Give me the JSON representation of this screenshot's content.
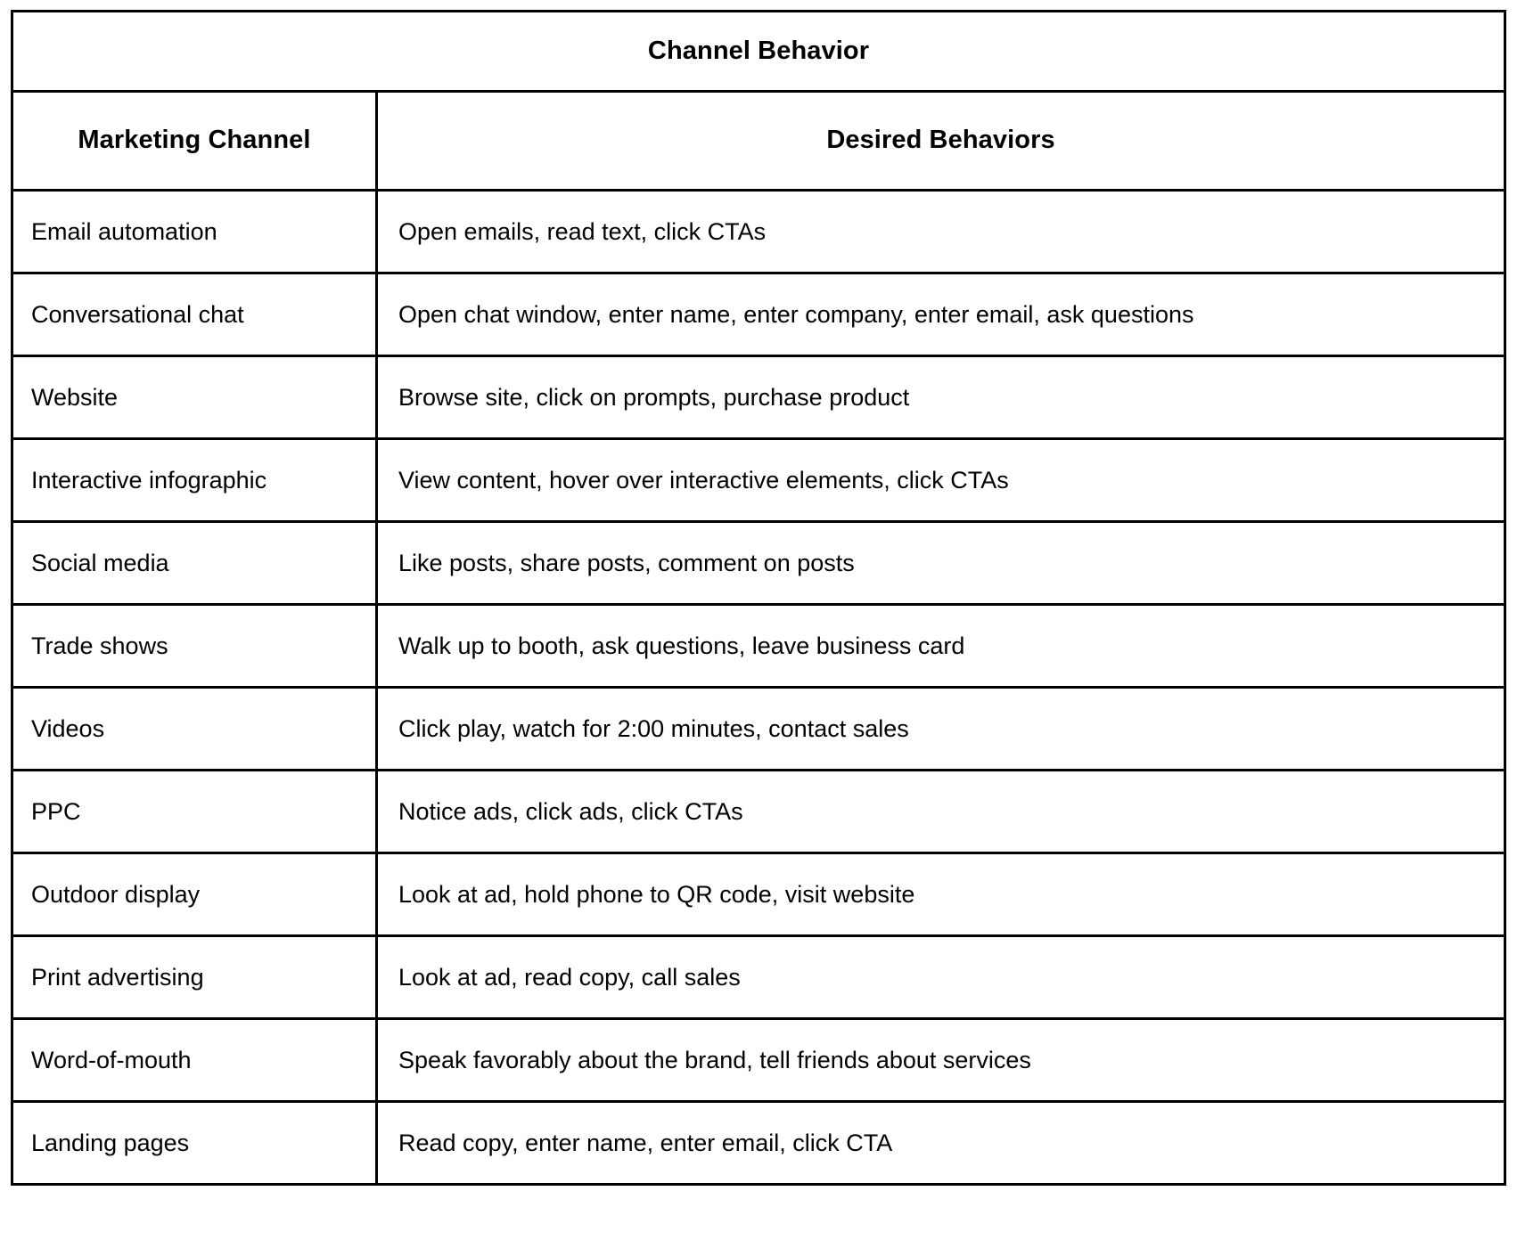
{
  "document": {
    "title": "Channel Behavior",
    "columns": {
      "channel": "Marketing Channel",
      "behavior": "Desired Behaviors"
    },
    "rows": [
      {
        "channel": "Email automation",
        "behavior": "Open emails, read text, click CTAs"
      },
      {
        "channel": "Conversational chat",
        "behavior": "Open chat window, enter name, enter company, enter email, ask questions"
      },
      {
        "channel": "Website",
        "behavior": "Browse site, click on prompts, purchase product"
      },
      {
        "channel": "Interactive infographic",
        "behavior": "View content, hover over interactive elements, click CTAs"
      },
      {
        "channel": "Social media",
        "behavior": "Like posts, share posts, comment on posts"
      },
      {
        "channel": "Trade shows",
        "behavior": "Walk up to booth, ask questions, leave business card"
      },
      {
        "channel": "Videos",
        "behavior": "Click play, watch for 2:00 minutes, contact sales"
      },
      {
        "channel": "PPC",
        "behavior": "Notice ads, click ads, click CTAs"
      },
      {
        "channel": "Outdoor display",
        "behavior": "Look at ad, hold phone to QR code, visit website"
      },
      {
        "channel": "Print advertising",
        "behavior": "Look at ad, read copy, call sales"
      },
      {
        "channel": "Word-of-mouth",
        "behavior": "Speak favorably about the brand, tell friends about services"
      },
      {
        "channel": "Landing pages",
        "behavior": "Read copy, enter name, enter email, click CTA"
      }
    ]
  },
  "style": {
    "border_color": "#000000",
    "text_color": "#000000",
    "background": "#ffffff"
  }
}
